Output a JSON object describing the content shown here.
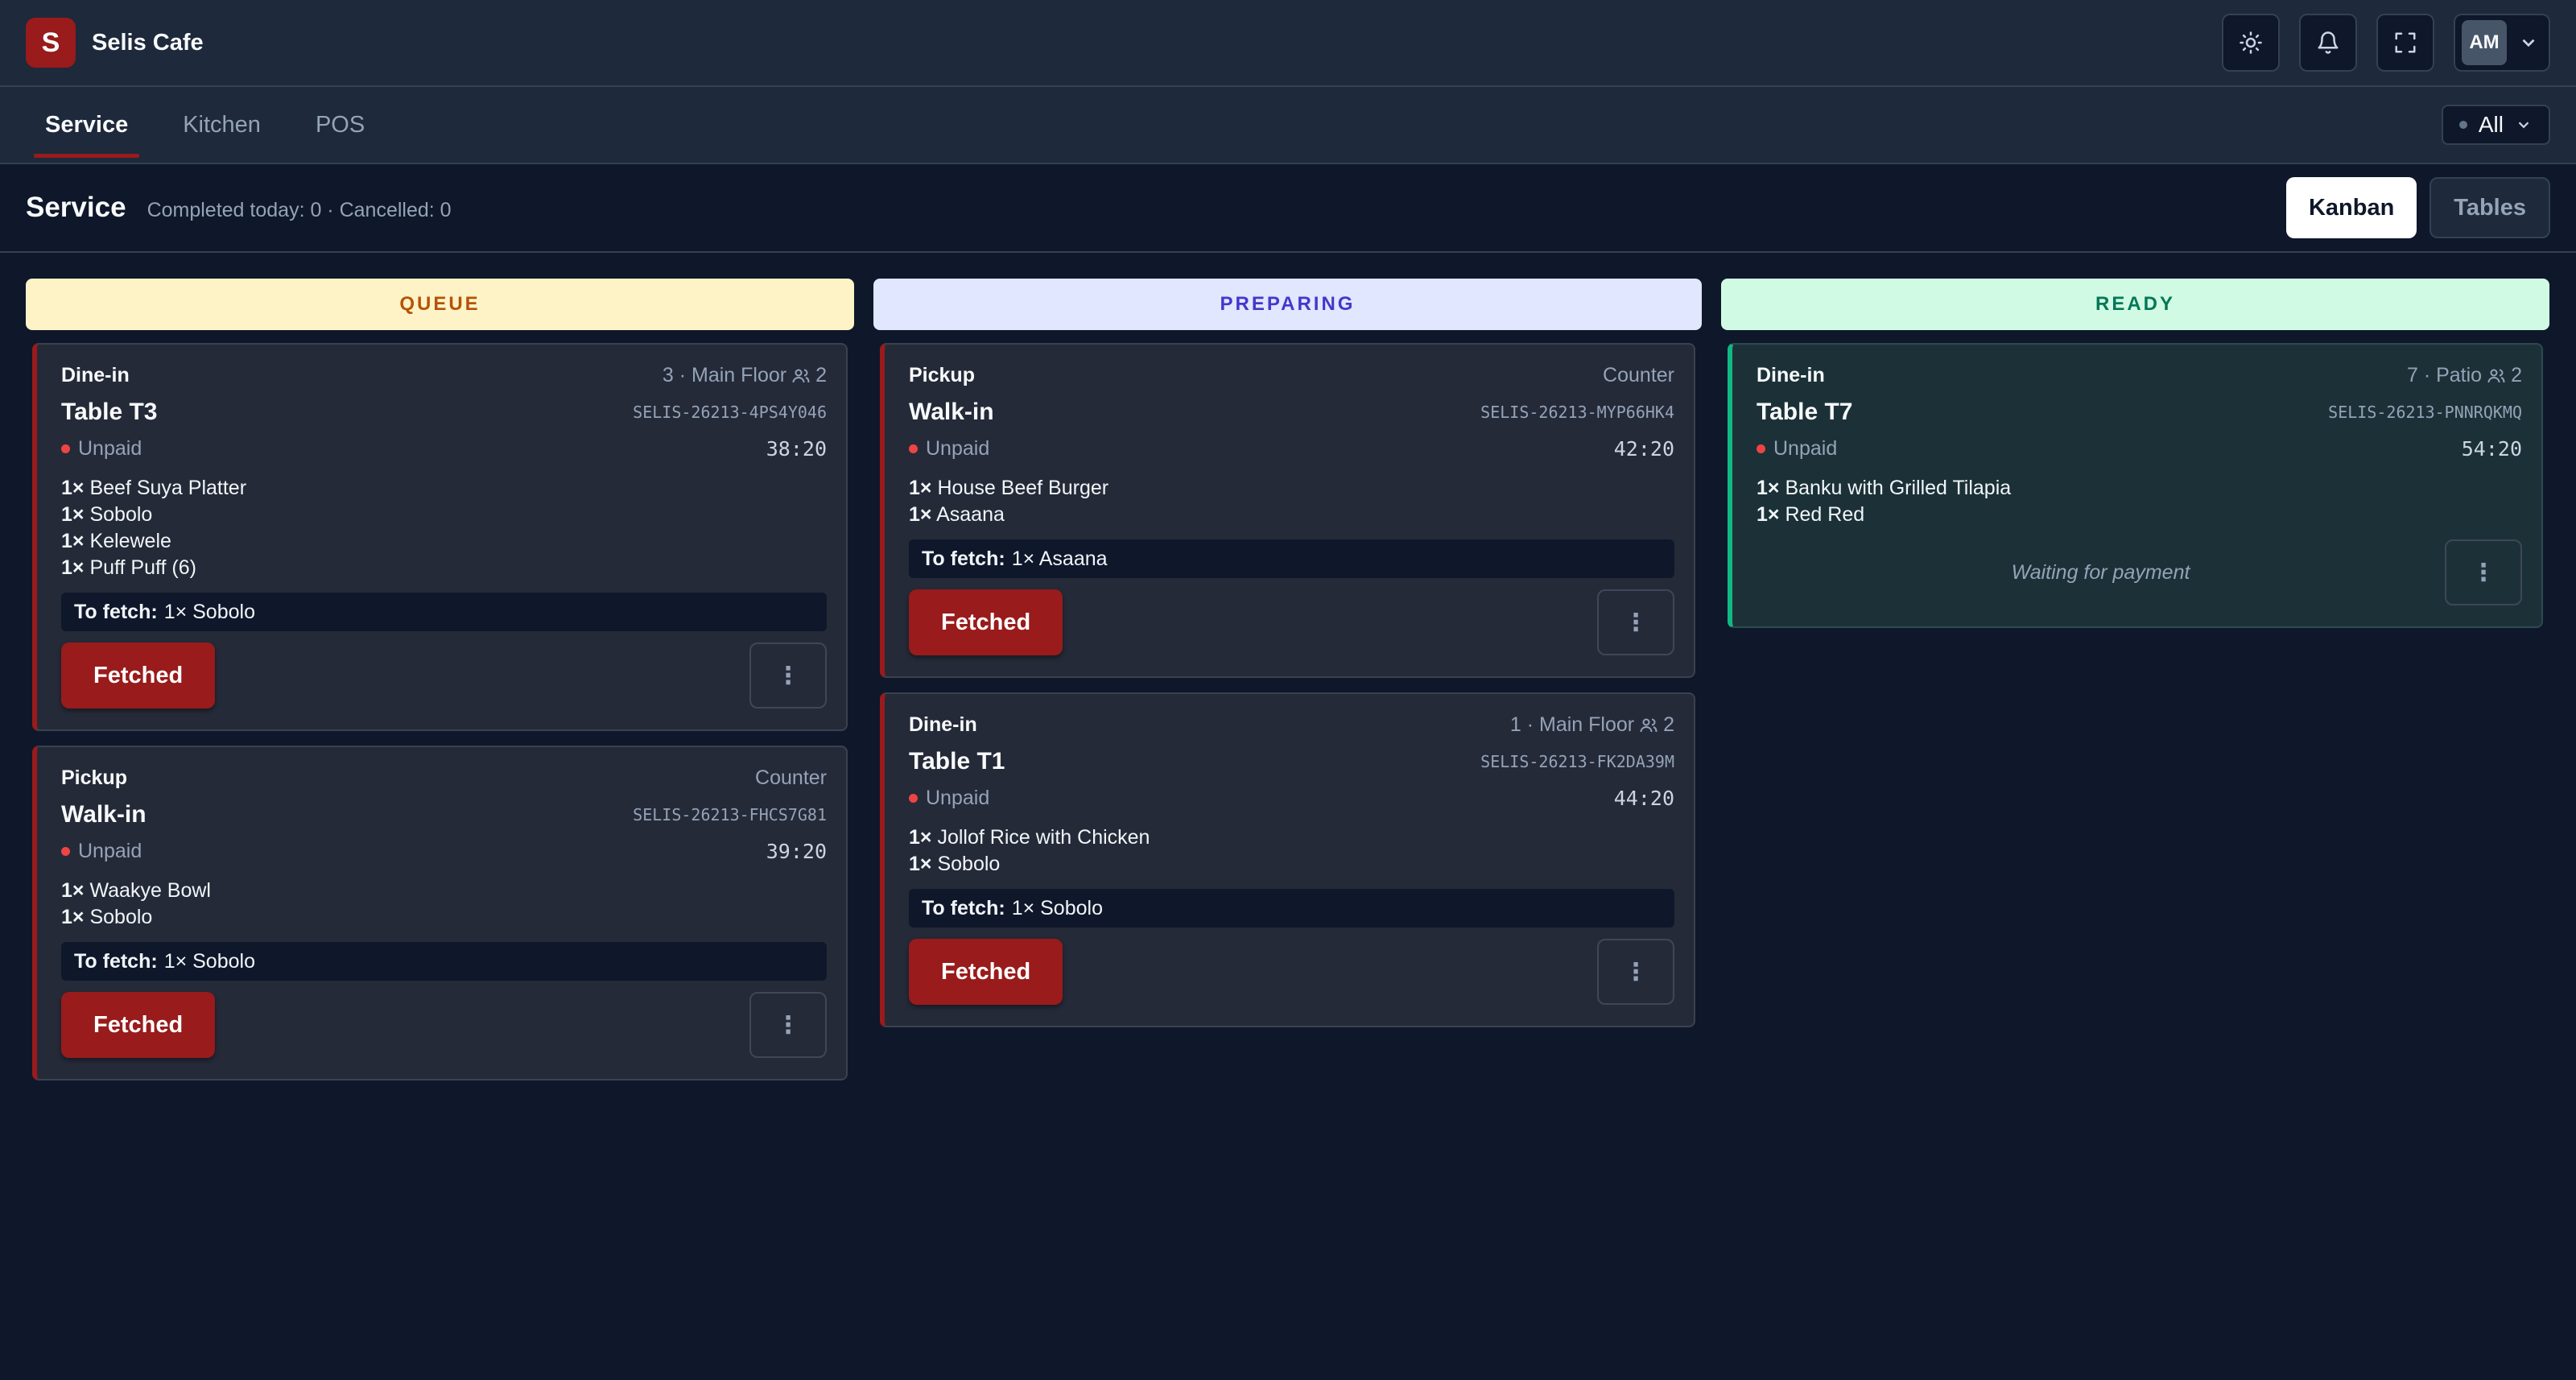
{
  "app": {
    "logo_letter": "S",
    "name": "Selis Cafe"
  },
  "header": {
    "user_initials": "AM"
  },
  "tabs": [
    {
      "label": "Service",
      "active": true
    },
    {
      "label": "Kitchen",
      "active": false
    },
    {
      "label": "POS",
      "active": false
    }
  ],
  "filter": {
    "value": "All"
  },
  "section": {
    "title": "Service",
    "stats": "Completed today: 0 · Cancelled: 0",
    "view_kanban": "Kanban",
    "view_tables": "Tables"
  },
  "columns": {
    "queue": {
      "label": "QUEUE",
      "cards": [
        {
          "kind": "Dine-in",
          "location": "3 · Main Floor",
          "guests": "2",
          "title": "Table T3",
          "order_id": "SELIS-26213-4PS4Y046",
          "payment": "Unpaid",
          "timer": "38:20",
          "items": [
            {
              "qty": "1×",
              "name": "Beef Suya Platter"
            },
            {
              "qty": "1×",
              "name": "Sobolo"
            },
            {
              "qty": "1×",
              "name": "Kelewele"
            },
            {
              "qty": "1×",
              "name": "Puff Puff (6)"
            }
          ],
          "fetch_label": "To fetch:",
          "fetch_value": "1× Sobolo",
          "action": "Fetched"
        },
        {
          "kind": "Pickup",
          "location": "Counter",
          "title": "Walk-in",
          "order_id": "SELIS-26213-FHCS7G81",
          "payment": "Unpaid",
          "timer": "39:20",
          "items": [
            {
              "qty": "1×",
              "name": "Waakye Bowl"
            },
            {
              "qty": "1×",
              "name": "Sobolo"
            }
          ],
          "fetch_label": "To fetch:",
          "fetch_value": "1× Sobolo",
          "action": "Fetched"
        }
      ]
    },
    "preparing": {
      "label": "PREPARING",
      "cards": [
        {
          "kind": "Pickup",
          "location": "Counter",
          "title": "Walk-in",
          "order_id": "SELIS-26213-MYP66HK4",
          "payment": "Unpaid",
          "timer": "42:20",
          "items": [
            {
              "qty": "1×",
              "name": "House Beef Burger"
            },
            {
              "qty": "1×",
              "name": "Asaana"
            }
          ],
          "fetch_label": "To fetch:",
          "fetch_value": "1× Asaana",
          "action": "Fetched"
        },
        {
          "kind": "Dine-in",
          "location": "1 · Main Floor",
          "guests": "2",
          "title": "Table T1",
          "order_id": "SELIS-26213-FK2DA39M",
          "payment": "Unpaid",
          "timer": "44:20",
          "items": [
            {
              "qty": "1×",
              "name": "Jollof Rice with Chicken"
            },
            {
              "qty": "1×",
              "name": "Sobolo"
            }
          ],
          "fetch_label": "To fetch:",
          "fetch_value": "1× Sobolo",
          "action": "Fetched"
        }
      ]
    },
    "ready": {
      "label": "READY",
      "cards": [
        {
          "kind": "Dine-in",
          "location": "7 · Patio",
          "guests": "2",
          "title": "Table T7",
          "order_id": "SELIS-26213-PNNRQKMQ",
          "payment": "Unpaid",
          "timer": "54:20",
          "items": [
            {
              "qty": "1×",
              "name": "Banku with Grilled Tilapia"
            },
            {
              "qty": "1×",
              "name": "Red Red"
            }
          ],
          "status_note": "Waiting for payment"
        }
      ]
    }
  },
  "colors": {
    "brand": "#991b1b",
    "background": "#0f172a",
    "surface": "#1e293b",
    "queue_header": "#fef3c7",
    "preparing_header": "#e0e7ff",
    "ready_header": "#d1fae5",
    "ready_accent": "#10b981",
    "unpaid_dot": "#ef4444"
  },
  "icons": {
    "theme": "sun-icon",
    "notifications": "bell-icon",
    "fullscreen": "expand-icon",
    "user_menu": "chevron-down-icon",
    "guests": "users-icon",
    "more": "vertical-dots-icon"
  }
}
